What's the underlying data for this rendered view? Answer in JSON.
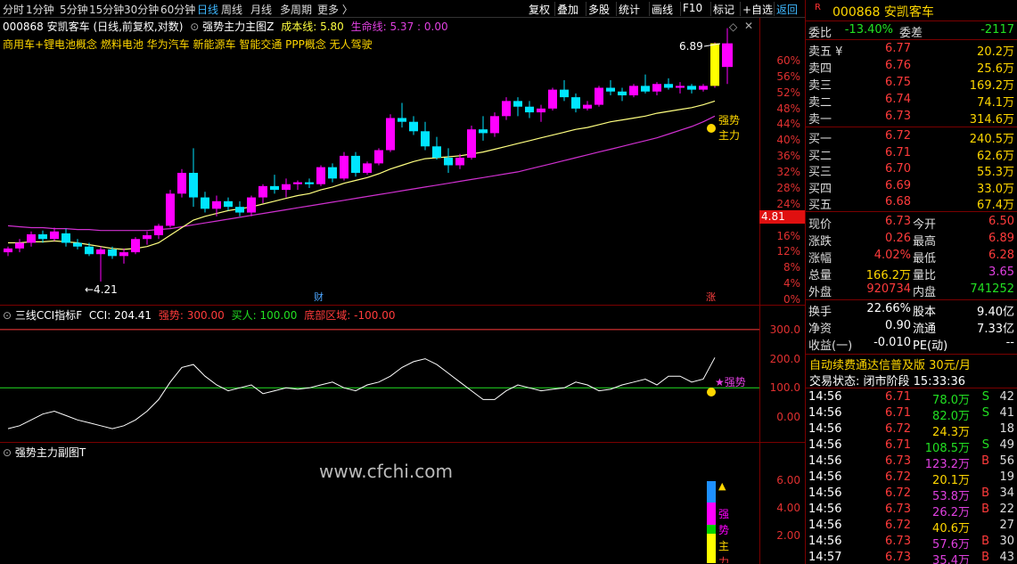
{
  "toolbar": {
    "periods": [
      "分时",
      "1分钟",
      "5分钟",
      "15分钟",
      "30分钟",
      "60分钟",
      "日线",
      "周线",
      "月线",
      "多周期",
      "更多 〉"
    ],
    "active_period": "日线",
    "right_buttons": [
      "复权",
      "叠加",
      "多股",
      "统计",
      "画线",
      "F10",
      "标记",
      "+自选",
      "返回"
    ]
  },
  "main_chart": {
    "header": "000868 安凯客车 (日线,前复权,对数)",
    "indicator_name": "强势主力主图Z",
    "cost_line": "成本线: 5.80",
    "life_line": "生命线: 5.37 : 0.00",
    "concepts": "商用车+锂电池概念 燃料电池 华为汽车 新能源车 智能交通 PPP概念 无人驾驶",
    "high_label": "6.89",
    "low_label": "4.21",
    "price_tag": "4.81",
    "strong_label_1": "强势",
    "strong_label_2": "主力",
    "marker_cai": "财",
    "marker_zhang": "涨",
    "y_ticks": [
      "60%",
      "56%",
      "52%",
      "48%",
      "44%",
      "40%",
      "36%",
      "32%",
      "28%",
      "24%",
      "20%",
      "16%",
      "12%",
      "8%",
      "4%",
      "0%"
    ],
    "settings_icon": "diamond-icon",
    "colors": {
      "up": "#ff00ff",
      "down": "#00e5ff",
      "ma_yellow": "#ffff80",
      "ma_purple": "#d030d0"
    }
  },
  "cci_panel": {
    "title": "三线CCI指标F",
    "cci": "CCI: 204.41",
    "strong": "强势: 300.00",
    "buy": "买人: 100.00",
    "bottom": "底部区域: -100.00",
    "y_ticks": [
      "300.0",
      "200.0",
      "100.0",
      "0.00"
    ],
    "strong_tag": "★强势"
  },
  "sub_panel": {
    "title": "强势主力副图T",
    "y_ticks": [
      "6.00",
      "4.00",
      "2.00"
    ],
    "vertical_text": [
      "强",
      "势",
      "主",
      "力"
    ],
    "watermark": "www.cfchi.com"
  },
  "chart_data": {
    "type": "candlestick",
    "title": "000868 安凯客车 (日线,前复权,对数)",
    "ohlc": [
      [
        4.52,
        4.58,
        4.48,
        4.56
      ],
      [
        4.56,
        4.66,
        4.52,
        4.62
      ],
      [
        4.62,
        4.74,
        4.58,
        4.71
      ],
      [
        4.71,
        4.75,
        4.62,
        4.66
      ],
      [
        4.66,
        4.78,
        4.64,
        4.74
      ],
      [
        4.72,
        4.77,
        4.58,
        4.62
      ],
      [
        4.62,
        4.66,
        4.55,
        4.58
      ],
      [
        4.58,
        4.62,
        4.48,
        4.5
      ],
      [
        4.5,
        4.58,
        4.21,
        4.55
      ],
      [
        4.55,
        4.58,
        4.45,
        4.48
      ],
      [
        4.48,
        4.56,
        4.4,
        4.52
      ],
      [
        4.52,
        4.68,
        4.5,
        4.66
      ],
      [
        4.66,
        4.74,
        4.6,
        4.7
      ],
      [
        4.7,
        4.82,
        4.66,
        4.8
      ],
      [
        4.8,
        5.18,
        4.78,
        5.14
      ],
      [
        5.14,
        5.4,
        5.1,
        5.36
      ],
      [
        5.36,
        5.62,
        5.0,
        5.1
      ],
      [
        5.1,
        5.16,
        4.94,
        4.98
      ],
      [
        4.98,
        5.12,
        4.9,
        5.06
      ],
      [
        5.06,
        5.1,
        4.96,
        5.0
      ],
      [
        5.0,
        5.06,
        4.9,
        4.94
      ],
      [
        4.94,
        5.12,
        4.9,
        5.1
      ],
      [
        5.1,
        5.24,
        5.04,
        5.22
      ],
      [
        5.22,
        5.34,
        5.14,
        5.18
      ],
      [
        5.18,
        5.3,
        5.1,
        5.24
      ],
      [
        5.24,
        5.28,
        5.18,
        5.26
      ],
      [
        5.26,
        5.3,
        5.2,
        5.24
      ],
      [
        5.24,
        5.44,
        5.22,
        5.42
      ],
      [
        5.42,
        5.46,
        5.26,
        5.3
      ],
      [
        5.3,
        5.58,
        5.28,
        5.54
      ],
      [
        5.54,
        5.58,
        5.32,
        5.36
      ],
      [
        5.36,
        5.48,
        5.34,
        5.46
      ],
      [
        5.46,
        5.62,
        5.44,
        5.6
      ],
      [
        5.6,
        5.98,
        5.58,
        5.94
      ],
      [
        5.94,
        6.1,
        5.84,
        5.9
      ],
      [
        5.9,
        5.96,
        5.76,
        5.8
      ],
      [
        5.8,
        5.9,
        5.6,
        5.64
      ],
      [
        5.64,
        5.74,
        5.5,
        5.52
      ],
      [
        5.52,
        5.62,
        5.36,
        5.44
      ],
      [
        5.44,
        5.56,
        5.4,
        5.52
      ],
      [
        5.52,
        5.86,
        5.5,
        5.82
      ],
      [
        5.82,
        5.96,
        5.7,
        5.78
      ],
      [
        5.78,
        6.0,
        5.74,
        5.96
      ],
      [
        5.96,
        6.16,
        5.92,
        6.12
      ],
      [
        6.12,
        6.16,
        5.96,
        6.06
      ],
      [
        6.06,
        6.12,
        5.94,
        6.0
      ],
      [
        6.0,
        6.08,
        5.9,
        6.04
      ],
      [
        6.04,
        6.26,
        6.02,
        6.24
      ],
      [
        6.24,
        6.34,
        6.12,
        6.16
      ],
      [
        6.16,
        6.2,
        6.0,
        6.04
      ],
      [
        6.04,
        6.12,
        6.02,
        6.08
      ],
      [
        6.08,
        6.28,
        6.06,
        6.26
      ],
      [
        6.26,
        6.34,
        6.18,
        6.22
      ],
      [
        6.22,
        6.26,
        6.12,
        6.18
      ],
      [
        6.18,
        6.3,
        6.16,
        6.28
      ],
      [
        6.28,
        6.4,
        6.2,
        6.22
      ],
      [
        6.22,
        6.32,
        6.18,
        6.3
      ],
      [
        6.3,
        6.36,
        6.24,
        6.26
      ],
      [
        6.26,
        6.32,
        6.2,
        6.28
      ],
      [
        6.28,
        6.3,
        6.2,
        6.24
      ],
      [
        6.24,
        6.3,
        6.22,
        6.28
      ],
      [
        6.28,
        6.74,
        6.26,
        6.73
      ]
    ],
    "ma_yellow": [
      4.62,
      4.62,
      4.63,
      4.63,
      4.64,
      4.63,
      4.62,
      4.6,
      4.58,
      4.56,
      4.55,
      4.56,
      4.58,
      4.62,
      4.7,
      4.78,
      4.86,
      4.9,
      4.93,
      4.96,
      4.98,
      5.0,
      5.03,
      5.06,
      5.09,
      5.12,
      5.14,
      5.18,
      5.21,
      5.25,
      5.28,
      5.31,
      5.35,
      5.4,
      5.44,
      5.48,
      5.51,
      5.52,
      5.53,
      5.54,
      5.56,
      5.58,
      5.61,
      5.64,
      5.67,
      5.7,
      5.73,
      5.76,
      5.79,
      5.82,
      5.84,
      5.87,
      5.9,
      5.92,
      5.94,
      5.96,
      5.99,
      6.01,
      6.03,
      6.05,
      6.08,
      6.12
    ],
    "ma_purple": [
      4.8,
      4.79,
      4.78,
      4.78,
      4.77,
      4.77,
      4.76,
      4.76,
      4.75,
      4.75,
      4.75,
      4.75,
      4.75,
      4.76,
      4.77,
      4.79,
      4.81,
      4.83,
      4.85,
      4.87,
      4.89,
      4.91,
      4.93,
      4.95,
      4.97,
      4.99,
      5.01,
      5.03,
      5.05,
      5.07,
      5.09,
      5.11,
      5.13,
      5.15,
      5.17,
      5.19,
      5.21,
      5.23,
      5.25,
      5.27,
      5.29,
      5.31,
      5.33,
      5.35,
      5.37,
      5.4,
      5.43,
      5.46,
      5.49,
      5.52,
      5.55,
      5.58,
      5.61,
      5.64,
      5.67,
      5.7,
      5.73,
      5.77,
      5.81,
      5.85,
      5.9,
      5.96
    ],
    "cci": [
      -40,
      -30,
      -10,
      10,
      20,
      5,
      -10,
      -20,
      -30,
      -40,
      -30,
      -10,
      20,
      60,
      120,
      170,
      180,
      140,
      110,
      90,
      100,
      110,
      80,
      90,
      100,
      95,
      100,
      110,
      120,
      100,
      90,
      110,
      120,
      140,
      170,
      190,
      200,
      180,
      150,
      120,
      90,
      60,
      60,
      90,
      110,
      100,
      90,
      95,
      100,
      120,
      110,
      90,
      95,
      110,
      120,
      130,
      110,
      140,
      140,
      120,
      130,
      204
    ],
    "sub_values": {
      "max": 7.0,
      "bar_segments": [
        "#1e90ff",
        "#ff00ff",
        "#00d000",
        "#ffff00"
      ]
    }
  },
  "quote": {
    "code_name": "000868 安凯客车",
    "weibi_label": "委比",
    "weibi": "-13.40%",
    "weicha_label": "委差",
    "weicha": "-2117",
    "asks": [
      {
        "label": "卖五 ¥",
        "price": "6.77",
        "vol": "20.2万"
      },
      {
        "label": "卖四",
        "price": "6.76",
        "vol": "25.6万"
      },
      {
        "label": "卖三",
        "price": "6.75",
        "vol": "169.2万"
      },
      {
        "label": "卖二",
        "price": "6.74",
        "vol": "74.1万"
      },
      {
        "label": "卖一",
        "price": "6.73",
        "vol": "314.6万"
      }
    ],
    "bids": [
      {
        "label": "买一",
        "price": "6.72",
        "vol": "240.5万"
      },
      {
        "label": "买二",
        "price": "6.71",
        "vol": "62.6万"
      },
      {
        "label": "买三",
        "price": "6.70",
        "vol": "55.3万"
      },
      {
        "label": "买四",
        "price": "6.69",
        "vol": "33.0万"
      },
      {
        "label": "买五",
        "price": "6.68",
        "vol": "67.4万"
      }
    ],
    "stats": [
      {
        "l1": "现价",
        "v1": "6.73",
        "c1": "c-red",
        "l2": "今开",
        "v2": "6.50",
        "c2": "c-red"
      },
      {
        "l1": "涨跌",
        "v1": "0.26",
        "c1": "c-red",
        "l2": "最高",
        "v2": "6.89",
        "c2": "c-red"
      },
      {
        "l1": "涨幅",
        "v1": "4.02%",
        "c1": "c-red",
        "l2": "最低",
        "v2": "6.28",
        "c2": "c-red"
      },
      {
        "l1": "总量",
        "v1": "166.2万",
        "c1": "c-yellow",
        "l2": "量比",
        "v2": "3.65",
        "c2": "c-purple"
      },
      {
        "l1": "外盘",
        "v1": "920734",
        "c1": "c-red",
        "l2": "内盘",
        "v2": "741252",
        "c2": "c-green"
      }
    ],
    "fin": [
      {
        "l1": "换手",
        "v1": "22.66%",
        "l2": "股本",
        "v2": "9.40亿"
      },
      {
        "l1": "净资",
        "v1": "0.90",
        "l2": "流通",
        "v2": "7.33亿"
      },
      {
        "l1": "收益(一)",
        "v1": "-0.010",
        "l2": "PE(动)",
        "v2": "--"
      }
    ],
    "promo": "自动续费通达信普及版  30元/月",
    "status": "交易状态: 闭市阶段 15:33:36",
    "ticks": [
      {
        "t": "14:56",
        "p": "6.71",
        "pc": "c-red",
        "v": "78.0万",
        "d": "S",
        "n": "42"
      },
      {
        "t": "14:56",
        "p": "6.71",
        "pc": "c-red",
        "v": "82.0万",
        "d": "S",
        "n": "41"
      },
      {
        "t": "14:56",
        "p": "6.72",
        "pc": "c-red",
        "v": "24.3万",
        "d": "",
        "n": "18"
      },
      {
        "t": "14:56",
        "p": "6.71",
        "pc": "c-red",
        "v": "108.5万",
        "d": "S",
        "n": "49"
      },
      {
        "t": "14:56",
        "p": "6.73",
        "pc": "c-red",
        "v": "123.2万",
        "d": "B",
        "n": "56"
      },
      {
        "t": "14:56",
        "p": "6.72",
        "pc": "c-red",
        "v": "20.1万",
        "d": "",
        "n": "19"
      },
      {
        "t": "14:56",
        "p": "6.72",
        "pc": "c-red",
        "v": "53.8万",
        "d": "B",
        "n": "34"
      },
      {
        "t": "14:56",
        "p": "6.73",
        "pc": "c-red",
        "v": "26.2万",
        "d": "B",
        "n": "22"
      },
      {
        "t": "14:56",
        "p": "6.72",
        "pc": "c-red",
        "v": "40.6万",
        "d": "",
        "n": "27"
      },
      {
        "t": "14:56",
        "p": "6.73",
        "pc": "c-red",
        "v": "57.6万",
        "d": "B",
        "n": "30"
      },
      {
        "t": "14:57",
        "p": "6.73",
        "pc": "c-red",
        "v": "35.4万",
        "d": "B",
        "n": "43"
      }
    ]
  }
}
